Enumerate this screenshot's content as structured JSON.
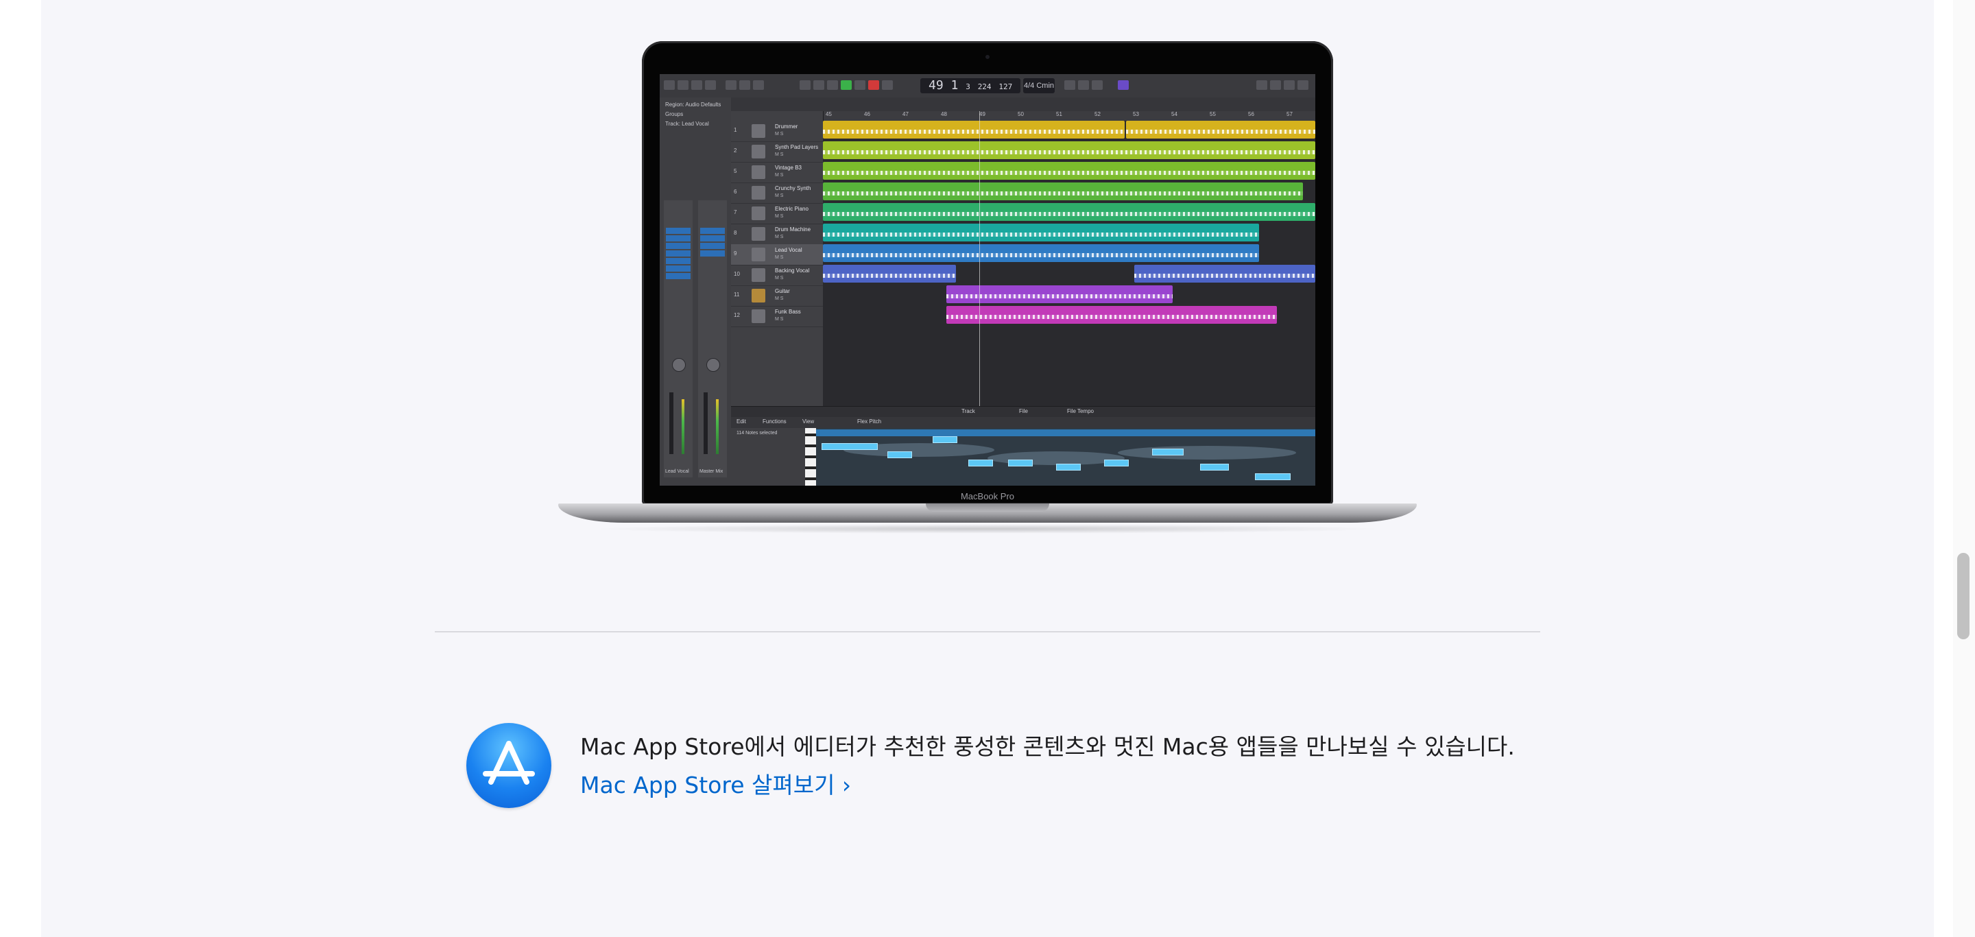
{
  "hero": {
    "device_label": "MacBook Pro",
    "logic": {
      "lcd_bar": "49",
      "lcd_beat": "1",
      "lcd_div": "3",
      "lcd_tick": "224",
      "lcd_tempo": "127",
      "lcd_sig": "4/4",
      "lcd_key": "Cmin",
      "inspector_lines": [
        "Region: Audio Defaults",
        "Groups",
        "Track: Lead Vocal"
      ],
      "strip_names": [
        "Lead Vocal",
        "Master Mix"
      ],
      "tracks": [
        {
          "num": "1",
          "name": "Drummer",
          "ms": "M S"
        },
        {
          "num": "2",
          "name": "Synth Pad Layers",
          "ms": "M S"
        },
        {
          "num": "5",
          "name": "Vintage B3",
          "ms": "M S"
        },
        {
          "num": "6",
          "name": "Crunchy Synth",
          "ms": "M S"
        },
        {
          "num": "7",
          "name": "Electric Piano",
          "ms": "M S"
        },
        {
          "num": "8",
          "name": "Drum Machine",
          "ms": "M S"
        },
        {
          "num": "9",
          "name": "Lead Vocal",
          "ms": "M S"
        },
        {
          "num": "10",
          "name": "Backing Vocal",
          "ms": "M S"
        },
        {
          "num": "11",
          "name": "Guitar",
          "ms": "M S"
        },
        {
          "num": "12",
          "name": "Funk Bass",
          "ms": "M S"
        }
      ],
      "ruler_ticks": [
        "45",
        "46",
        "47",
        "48",
        "49",
        "50",
        "51",
        "52",
        "53",
        "54",
        "55",
        "56",
        "57"
      ],
      "editor_tabs": [
        "Track",
        "File",
        "File Tempo"
      ],
      "editor_menu": [
        "Edit",
        "Functions",
        "View",
        "Flex Pitch"
      ],
      "editor_info": "114 Notes selected",
      "colors": {
        "yellow": "#d6b21d",
        "lime": "#9cc22a",
        "green": "#58b43a",
        "teal": "#1aa89e",
        "blue": "#2f7bc4",
        "indigo": "#4d64c6",
        "purple": "#9a45d0",
        "magenta": "#c23ab8"
      }
    }
  },
  "app_store": {
    "icon": "app-store-icon",
    "tagline": "Mac App Store에서 에디터가 추천한 풍성한 콘텐츠와 멋진 Mac용 앱들을 만나보실 수 있습니다.",
    "link_label": "Mac App Store 살펴보기 ›"
  }
}
